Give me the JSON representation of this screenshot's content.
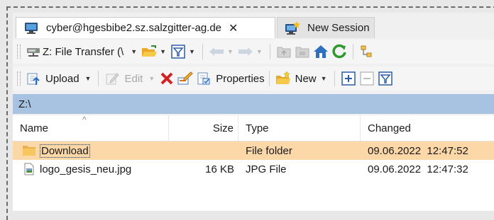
{
  "tabs": [
    {
      "label": "cyber@hgesbibe2.sz.salzgitter-ag.de",
      "icon": "monitor-icon",
      "active": true
    },
    {
      "label": "New Session",
      "icon": "new-session-icon",
      "active": false
    }
  ],
  "toolbar1": {
    "drive_select": "Z: File Transfer (\\"
  },
  "toolbar2": {
    "upload_label": "Upload",
    "edit_label": "Edit",
    "properties_label": "Properties",
    "new_label": "New"
  },
  "path": "Z:\\",
  "columns": {
    "name": "Name",
    "size": "Size",
    "type": "Type",
    "changed": "Changed"
  },
  "files": [
    {
      "name": "Download",
      "size": "",
      "type": "File folder",
      "changed": "09.06.2022  12:47:52",
      "icon": "folder-icon",
      "selected": true
    },
    {
      "name": "logo_gesis_neu.jpg",
      "size": "16 KB",
      "type": "JPG File",
      "changed": "09.06.2022  12:47:32",
      "icon": "image-file-icon",
      "selected": false
    }
  ],
  "colors": {
    "selection": "#fcd7a8",
    "path_bar": "#a8c3e2"
  }
}
